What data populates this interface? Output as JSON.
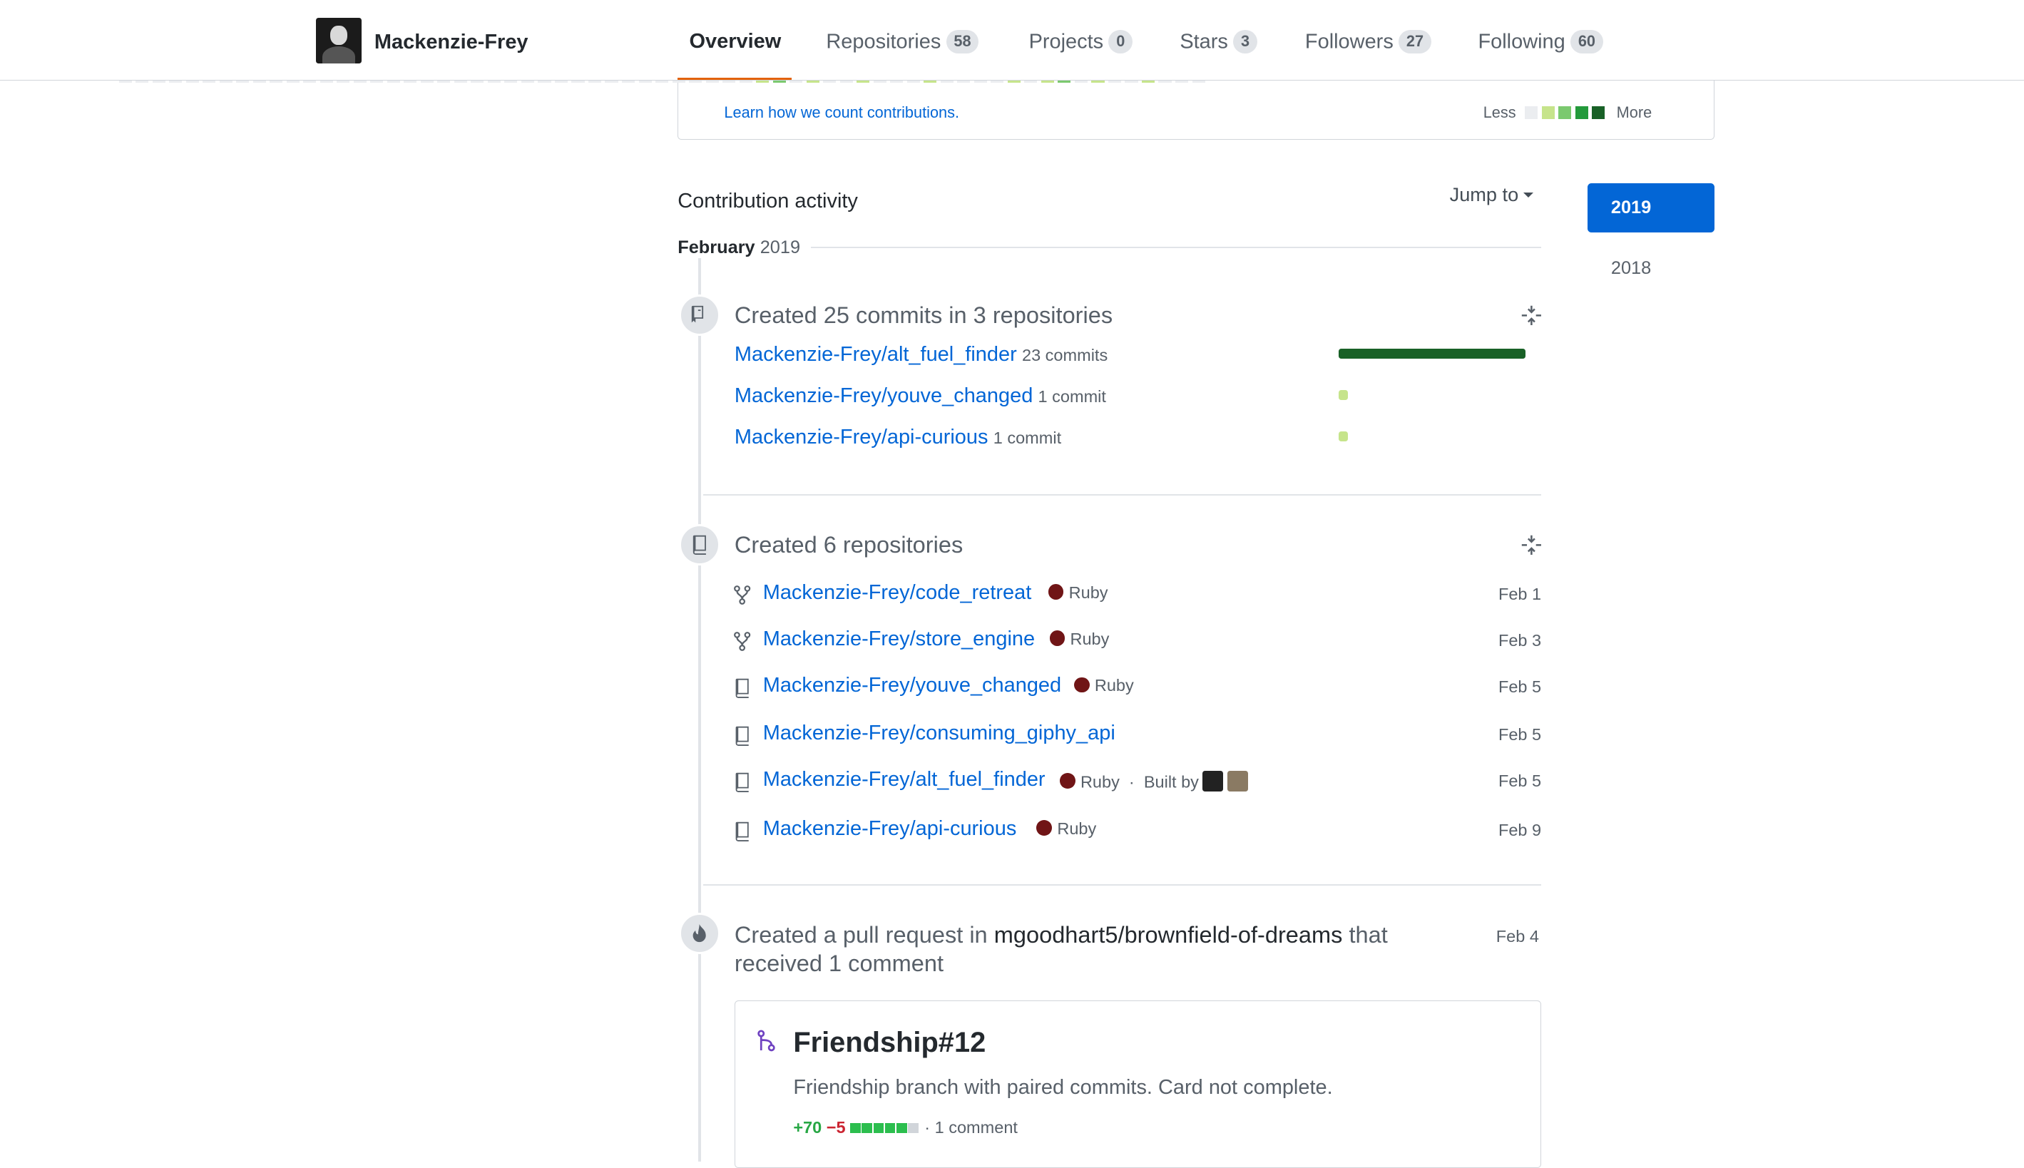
{
  "header": {
    "username": "Mackenzie-Frey",
    "tabs": [
      {
        "label": "Overview",
        "count": null,
        "active": true
      },
      {
        "label": "Repositories",
        "count": "58"
      },
      {
        "label": "Projects",
        "count": "0"
      },
      {
        "label": "Stars",
        "count": "3"
      },
      {
        "label": "Followers",
        "count": "27"
      },
      {
        "label": "Following",
        "count": "60"
      }
    ]
  },
  "graph": {
    "learn_link": "Learn how we count contributions.",
    "legend_less": "Less",
    "legend_more": "More",
    "legend_colors": [
      "#ebedf0",
      "#c6e48b",
      "#7bc96f",
      "#239a3b",
      "#196127"
    ]
  },
  "activity": {
    "title": "Contribution activity",
    "jump_to": "Jump to",
    "years": [
      "2019",
      "2018"
    ],
    "month": "February",
    "month_year": "2019",
    "commits": {
      "title_prefix": "Created 25 commits in 3 repositories",
      "rows": [
        {
          "repo": "Mackenzie-Frey/alt_fuel_finder",
          "count": "23 commits",
          "share": 1.0
        },
        {
          "repo": "Mackenzie-Frey/youve_changed",
          "count": "1 commit",
          "share": 0.04
        },
        {
          "repo": "Mackenzie-Frey/api-curious",
          "count": "1 commit",
          "share": 0.04
        }
      ]
    },
    "repos": {
      "title": "Created 6 repositories",
      "rows": [
        {
          "name": "Mackenzie-Frey/code_retreat",
          "icon": "fork-icon",
          "lang": "Ruby",
          "date": "Feb 1"
        },
        {
          "name": "Mackenzie-Frey/store_engine",
          "icon": "fork-icon",
          "lang": "Ruby",
          "date": "Feb 3"
        },
        {
          "name": "Mackenzie-Frey/youve_changed",
          "icon": "repo-icon",
          "lang": "Ruby",
          "date": "Feb 5"
        },
        {
          "name": "Mackenzie-Frey/consuming_giphy_api",
          "icon": "repo-icon",
          "lang": "",
          "date": "Feb 5"
        },
        {
          "name": "Mackenzie-Frey/alt_fuel_finder",
          "icon": "repo-icon",
          "lang": "Ruby",
          "built_by": "Built by",
          "date": "Feb 5"
        },
        {
          "name": "Mackenzie-Frey/api-curious",
          "icon": "repo-icon",
          "lang": "Ruby",
          "date": "Feb 9"
        }
      ],
      "lang_color": "#701516"
    },
    "pull_request": {
      "title_prefix": "Created a pull request in",
      "repo": "mgoodhart5/brownfield-of-dreams",
      "title_suffix": "that received 1 comment",
      "date": "Feb 4",
      "card": {
        "name": "Friendship#12",
        "description": "Friendship branch with paired commits. Card not complete.",
        "additions": "+70",
        "deletions": "−5",
        "comments": "1 comment"
      }
    }
  }
}
